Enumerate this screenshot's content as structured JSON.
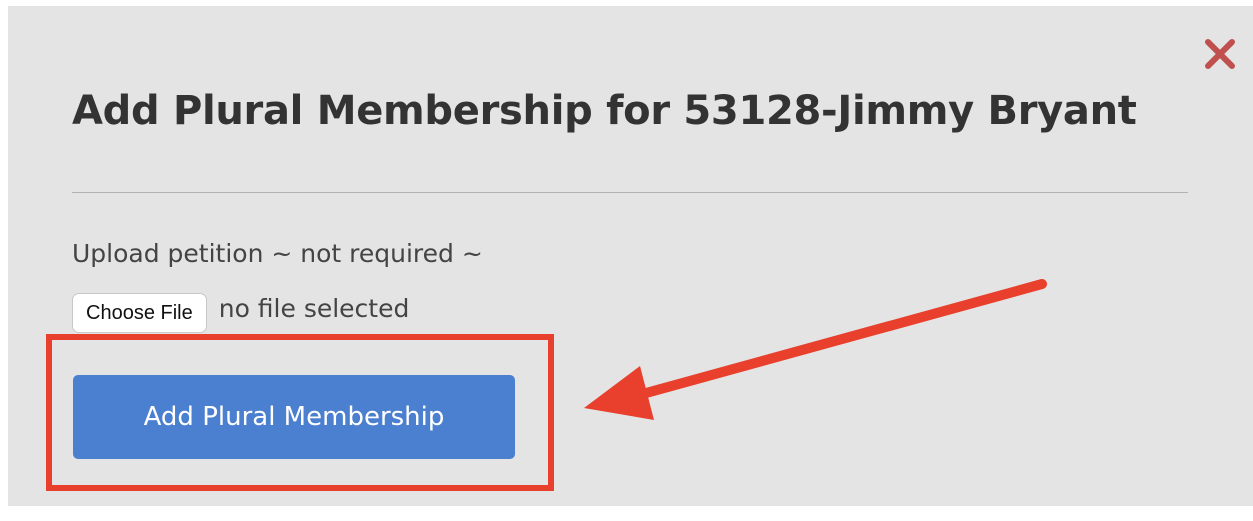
{
  "dialog": {
    "title": "Add Plural Membership for 53128-Jimmy Bryant",
    "close_icon": "close-icon",
    "upload_label": "Upload petition ~ not required ~",
    "file_input": {
      "button_label": "Choose File",
      "status_text": "no file selected"
    },
    "submit_label": "Add Plural Membership"
  },
  "annotation": {
    "highlight_color": "#e8402c",
    "arrow_color": "#e8402c"
  },
  "colors": {
    "modal_background": "#e4e4e4",
    "close_icon": "#c0504d",
    "primary_button": "#4a80cf"
  }
}
